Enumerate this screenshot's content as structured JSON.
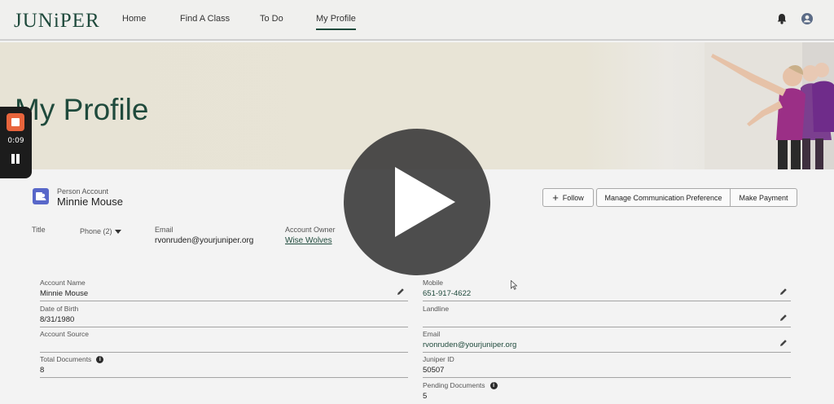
{
  "app": {
    "logo_text": "JUNiPER",
    "brand_color": "#1f4a3c"
  },
  "nav": {
    "items": [
      {
        "label": "Home"
      },
      {
        "label": "Find A Class"
      },
      {
        "label": "To Do"
      },
      {
        "label": "My Profile",
        "active": true
      }
    ],
    "icons": [
      "bell-icon",
      "user-avatar-icon"
    ]
  },
  "hero": {
    "title": "My Profile"
  },
  "recorder": {
    "time": "0:09",
    "icons": [
      "stop-icon",
      "pause-icon"
    ]
  },
  "record": {
    "type": "Person Account",
    "name": "Minnie Mouse",
    "actions": {
      "follow": "Follow",
      "manage": "Manage Communication Preference",
      "pay": "Make Payment"
    },
    "highlights": {
      "title_label": "Title",
      "phone_label": "Phone (2)",
      "email_label": "Email",
      "email_value": "rvonruden@yourjuniper.org",
      "owner_label": "Account Owner",
      "owner_value": "Wise Wolves"
    }
  },
  "fields": {
    "account_name": {
      "label": "Account Name",
      "value": "Minnie Mouse"
    },
    "dob": {
      "label": "Date of Birth",
      "value": "8/31/1980"
    },
    "account_source": {
      "label": "Account Source",
      "value": ""
    },
    "total_documents": {
      "label": "Total Documents",
      "value": "8"
    },
    "mobile": {
      "label": "Mobile",
      "value": "651-917-4622"
    },
    "landline": {
      "label": "Landline",
      "value": ""
    },
    "email": {
      "label": "Email",
      "value": "rvonruden@yourjuniper.org"
    },
    "juniper_id": {
      "label": "Juniper ID",
      "value": "50507"
    },
    "pending_documents": {
      "label": "Pending Documents",
      "value": "5"
    }
  },
  "video": {
    "control": "play-icon"
  }
}
